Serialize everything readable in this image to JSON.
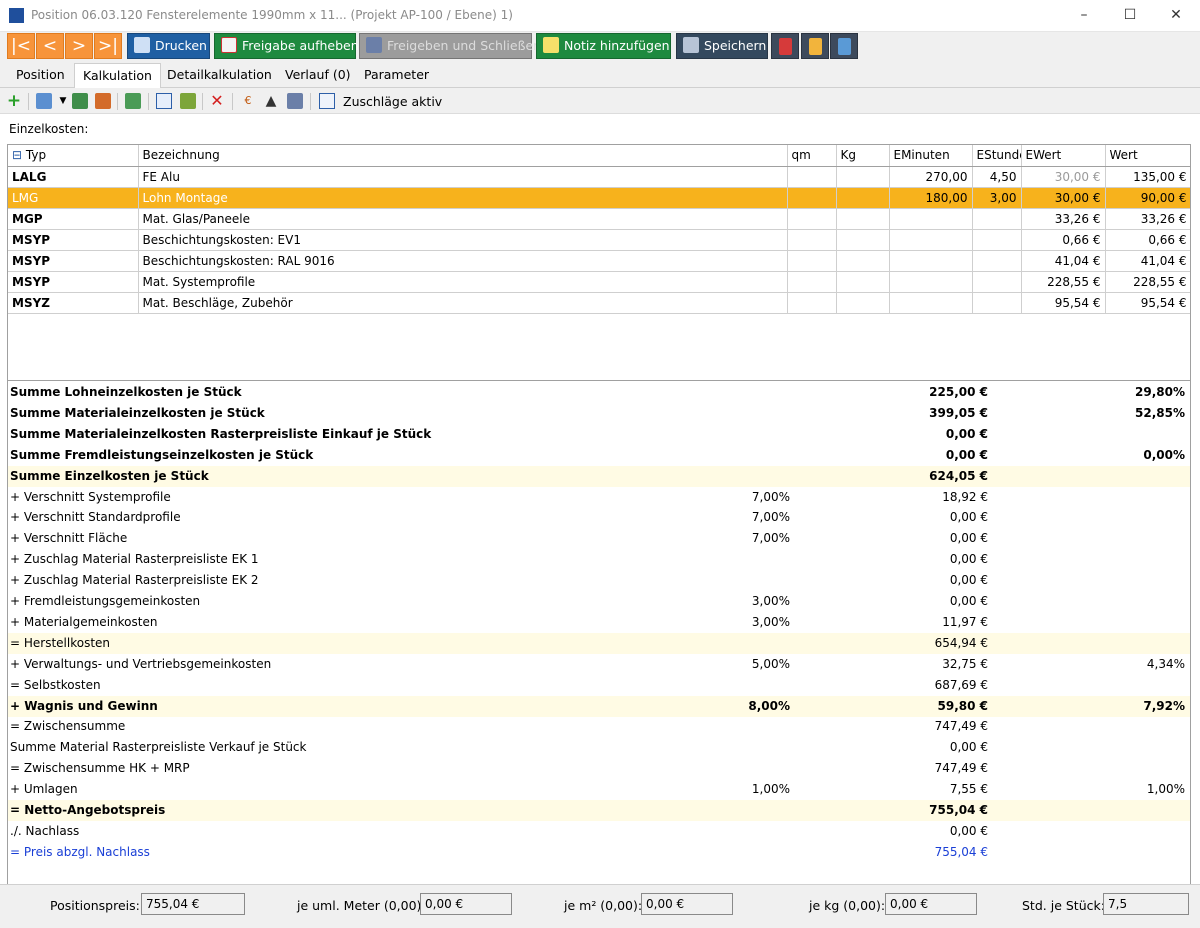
{
  "window": {
    "title": "Position 06.03.120 Fensterelemente 1990mm x 11... (Projekt AP-100 / Ebene) 1)",
    "minimize": "–",
    "maximize": "☐",
    "close": "✕"
  },
  "toolbar": {
    "nav": [
      "|<",
      "<",
      ">",
      ">|"
    ],
    "print": "Drucken",
    "release_cancel": "Freigabe aufheben",
    "release_close": "Freigeben und Schließen",
    "add_note": "Notiz hinzufügen",
    "save": "Speichern"
  },
  "tabs": [
    "Position",
    "Kalkulation",
    "Detailkalkulation",
    "Verlauf (0)",
    "Parameter"
  ],
  "active_tab": "Kalkulation",
  "iconbar": {
    "surcharges_label": "Zuschläge aktiv"
  },
  "grid": {
    "section_label": "Einzelkosten:",
    "columns": [
      "Typ",
      "Bezeichnung",
      "qm",
      "Kg",
      "EMinuten",
      "EStunde",
      "EWert",
      "Wert"
    ],
    "collapse_icon": "⊟",
    "rows": [
      {
        "typ": "LALG",
        "bezeichnung": "FE Alu",
        "qm": "",
        "kg": "",
        "eminuten": "270,00",
        "estunde": "4,50",
        "ewert": "30,00 €",
        "wert": "135,00 €"
      },
      {
        "typ": "LMG",
        "bezeichnung": "Lohn Montage",
        "qm": "",
        "kg": "",
        "eminuten": "180,00",
        "estunde": "3,00",
        "ewert": "30,00 €",
        "wert": "90,00 €"
      },
      {
        "typ": "MGP",
        "bezeichnung": "Mat. Glas/Paneele",
        "qm": "",
        "kg": "",
        "eminuten": "",
        "estunde": "",
        "ewert": "33,26 €",
        "wert": "33,26 €"
      },
      {
        "typ": "MSYP",
        "bezeichnung": "Beschichtungskosten: EV1",
        "qm": "",
        "kg": "",
        "eminuten": "",
        "estunde": "",
        "ewert": "0,66 €",
        "wert": "0,66 €"
      },
      {
        "typ": "MSYP",
        "bezeichnung": "Beschichtungskosten: RAL 9016",
        "qm": "",
        "kg": "",
        "eminuten": "",
        "estunde": "",
        "ewert": "41,04 €",
        "wert": "41,04 €"
      },
      {
        "typ": "MSYP",
        "bezeichnung": "Mat. Systemprofile",
        "qm": "",
        "kg": "",
        "eminuten": "",
        "estunde": "",
        "ewert": "228,55 €",
        "wert": "228,55 €"
      },
      {
        "typ": "MSYZ",
        "bezeichnung": "Mat. Beschläge, Zubehör",
        "qm": "",
        "kg": "",
        "eminuten": "",
        "estunde": "",
        "ewert": "95,54 €",
        "wert": "95,54 €"
      }
    ]
  },
  "summary": [
    {
      "label": "Summe Lohneinzelkosten je Stück",
      "pct": "",
      "amount": "225,00 €",
      "share": "29,80%",
      "style": "b"
    },
    {
      "label": "Summe Materialeinzelkosten je Stück",
      "pct": "",
      "amount": "399,05 €",
      "share": "52,85%",
      "style": "b"
    },
    {
      "label": "Summe Materialeinzelkosten Rasterpreisliste Einkauf je Stück",
      "pct": "",
      "amount": "0,00 €",
      "share": "",
      "style": "b"
    },
    {
      "label": "Summe Fremdleistungseinzelkosten je Stück",
      "pct": "",
      "amount": "0,00 €",
      "share": "0,00%",
      "style": "b"
    },
    {
      "label": "Summe Einzelkosten je Stück",
      "pct": "",
      "amount": "624,05 €",
      "share": "",
      "style": "b hl"
    },
    {
      "label": "+ Verschnitt Systemprofile",
      "pct": "7,00%",
      "amount": "18,92 €",
      "share": "",
      "style": ""
    },
    {
      "label": "+ Verschnitt Standardprofile",
      "pct": "7,00%",
      "amount": "0,00 €",
      "share": "",
      "style": ""
    },
    {
      "label": "+ Verschnitt Fläche",
      "pct": "7,00%",
      "amount": "0,00 €",
      "share": "",
      "style": ""
    },
    {
      "label": "+ Zuschlag Material Rasterpreisliste EK 1",
      "pct": "",
      "amount": "0,00 €",
      "share": "",
      "style": ""
    },
    {
      "label": "+ Zuschlag Material Rasterpreisliste EK 2",
      "pct": "",
      "amount": "0,00 €",
      "share": "",
      "style": ""
    },
    {
      "label": "+ Fremdleistungsgemeinkosten",
      "pct": "3,00%",
      "amount": "0,00 €",
      "share": "",
      "style": ""
    },
    {
      "label": "+ Materialgemeinkosten",
      "pct": "3,00%",
      "amount": "11,97 €",
      "share": "",
      "style": ""
    },
    {
      "label": "= Herstellkosten",
      "pct": "",
      "amount": "654,94 €",
      "share": "",
      "style": "hl"
    },
    {
      "label": "+ Verwaltungs- und Vertriebsgemeinkosten",
      "pct": "5,00%",
      "amount": "32,75 €",
      "share": "4,34%",
      "style": ""
    },
    {
      "label": "= Selbstkosten",
      "pct": "",
      "amount": "687,69 €",
      "share": "",
      "style": ""
    },
    {
      "label": "+ Wagnis und Gewinn",
      "pct": "8,00%",
      "amount": "59,80 €",
      "share": "7,92%",
      "style": "b hl"
    },
    {
      "label": "= Zwischensumme",
      "pct": "",
      "amount": "747,49 €",
      "share": "",
      "style": ""
    },
    {
      "label": "Summe Material Rasterpreisliste Verkauf je Stück",
      "pct": "",
      "amount": "0,00 €",
      "share": "",
      "style": ""
    },
    {
      "label": "= Zwischensumme HK + MRP",
      "pct": "",
      "amount": "747,49 €",
      "share": "",
      "style": ""
    },
    {
      "label": "+ Umlagen",
      "pct": "1,00%",
      "amount": "7,55 €",
      "share": "1,00%",
      "style": ""
    },
    {
      "label": "= Netto-Angebotspreis",
      "pct": "",
      "amount": "755,04 €",
      "share": "",
      "style": "b hl"
    },
    {
      "label": "./. Nachlass",
      "pct": "",
      "amount": "0,00 €",
      "share": "",
      "style": ""
    },
    {
      "label": "= Preis abzgl. Nachlass",
      "pct": "",
      "amount": "755,04 €",
      "share": "",
      "style": "blue"
    }
  ],
  "footer": {
    "position_price_label": "Positionspreis:",
    "position_price": "755,04 €",
    "per_meter_label": "je uml. Meter (0,00):",
    "per_meter": "0,00 €",
    "per_m2_label": "je m² (0,00):",
    "per_m2": "0,00 €",
    "per_kg_label": "je kg (0,00):",
    "per_kg": "0,00 €",
    "hours_label": "Std. je Stück:",
    "hours": "7,5"
  },
  "icons": {
    "add": "plus-icon",
    "delete": "delete-x-icon",
    "print": "printer-icon",
    "save": "floppy-icon"
  },
  "colors": {
    "nav_orange": "#f7943a",
    "selected_row": "#f7b21c",
    "highlight_row": "#fffbe4",
    "link_blue": "#1a3fd6"
  }
}
